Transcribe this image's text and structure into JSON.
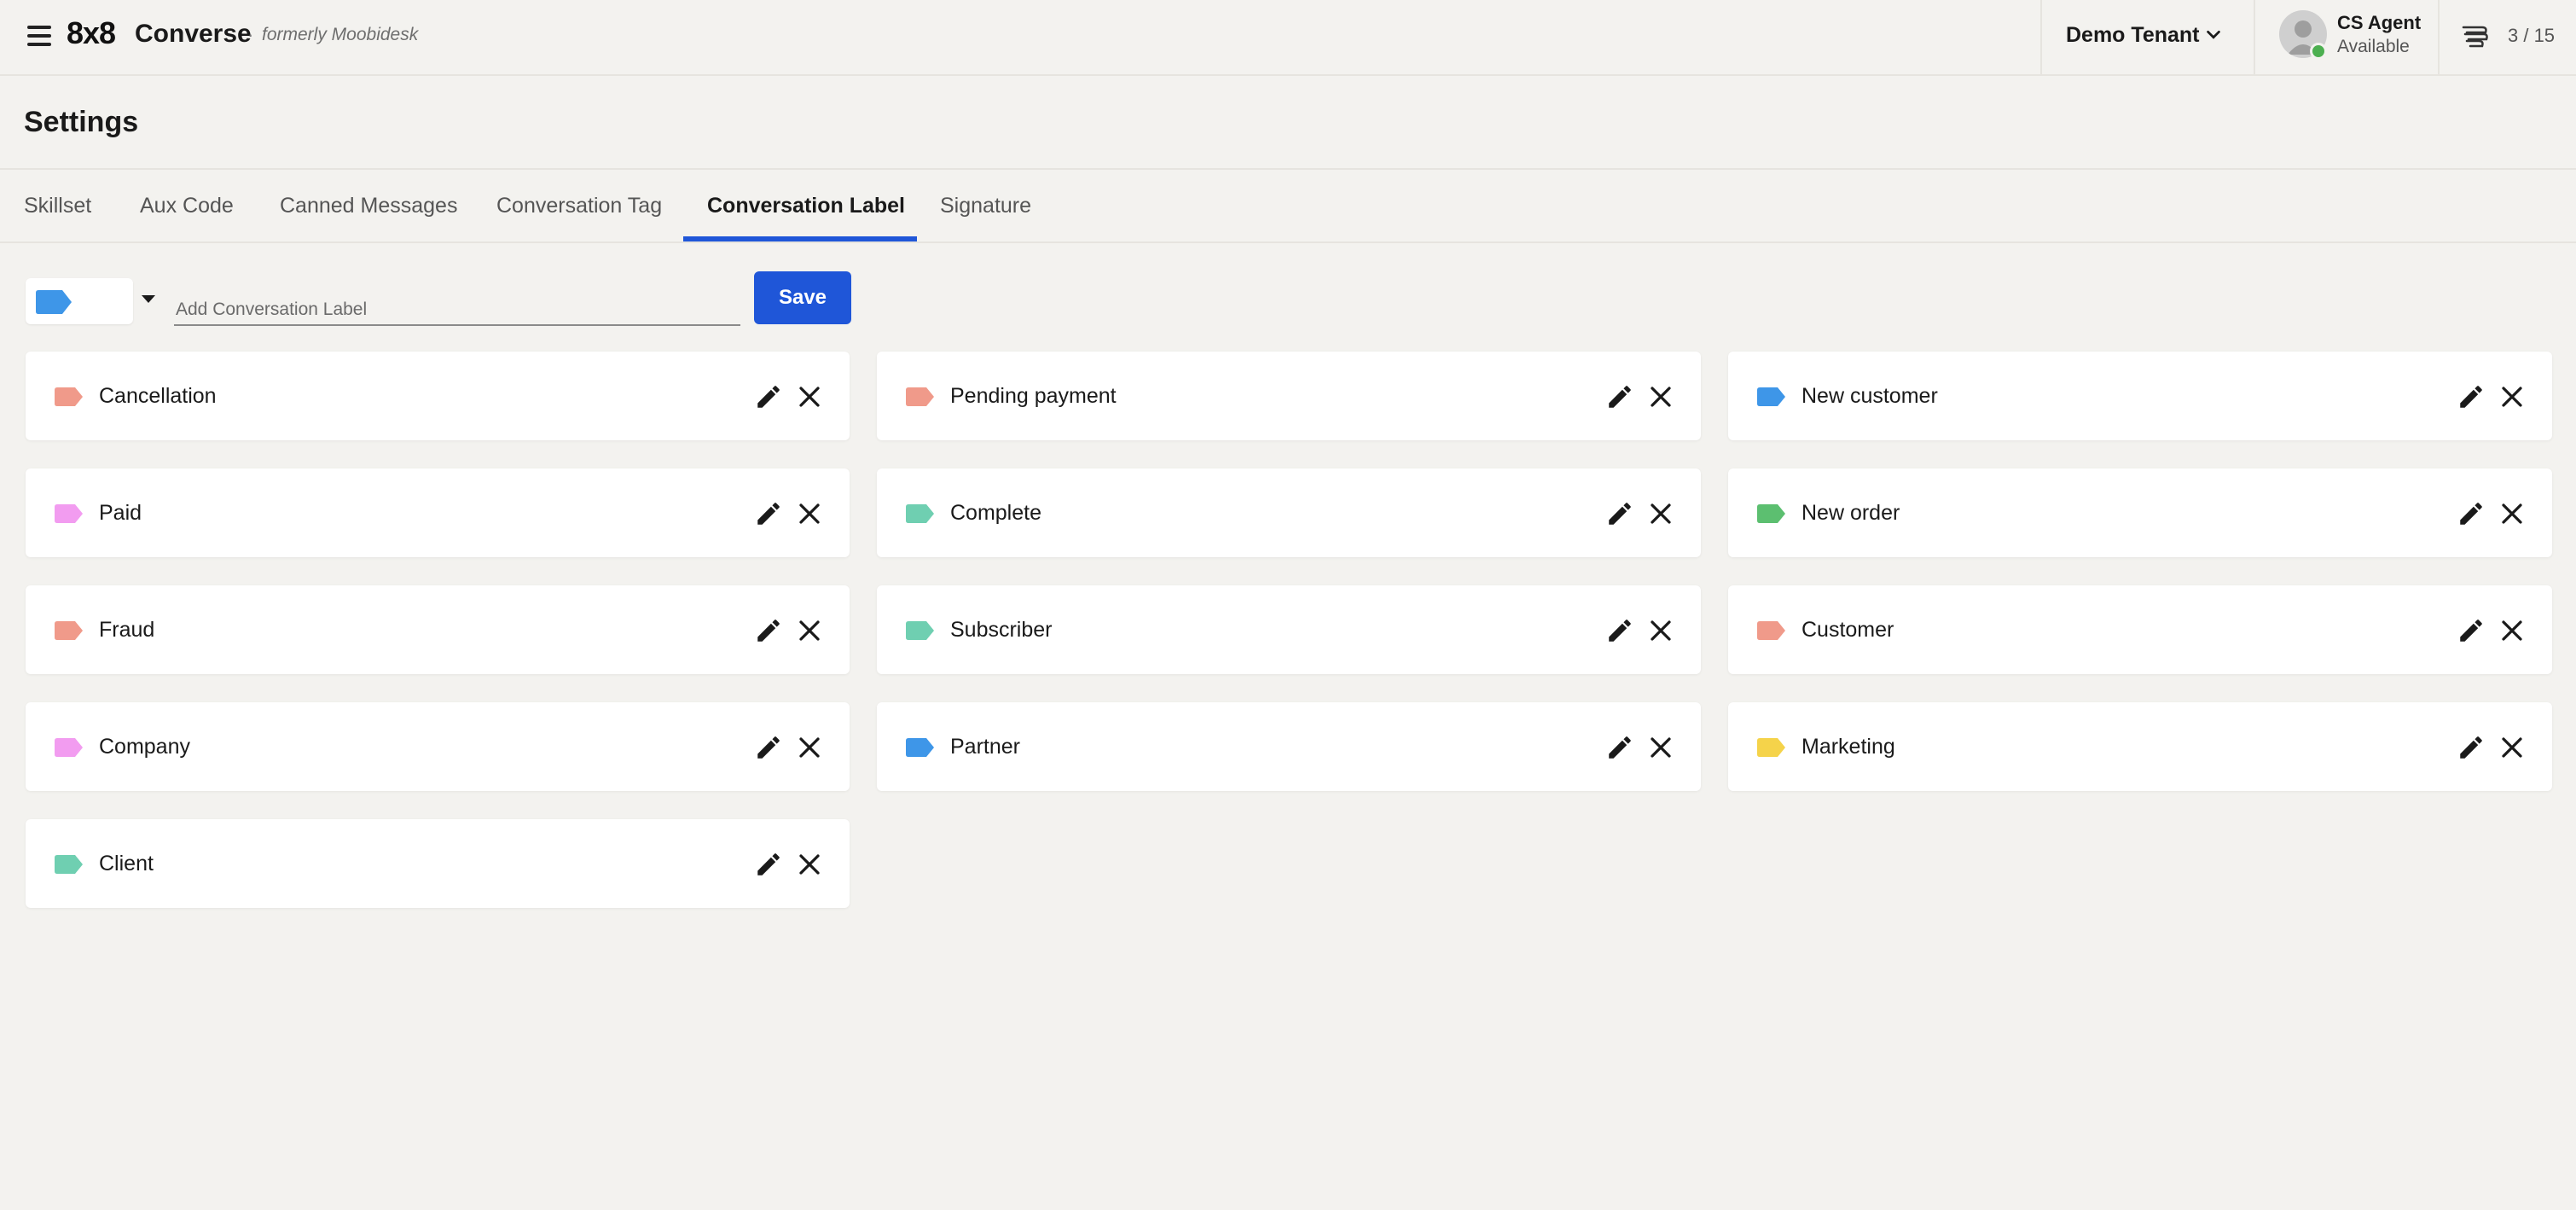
{
  "topbar": {
    "brand_logo": "8x8",
    "brand_name": "Converse",
    "brand_separator": "·",
    "brand_subtitle": "formerly Moobidesk",
    "tenant": "Demo Tenant",
    "agent_name": "CS Agent",
    "agent_status": "Available",
    "queue_count": "3 / 15",
    "status_color": "#4caf50"
  },
  "page": {
    "title": "Settings"
  },
  "tabs": [
    {
      "label": "Skillset",
      "active": false
    },
    {
      "label": "Aux Code",
      "active": false
    },
    {
      "label": "Canned Messages",
      "active": false
    },
    {
      "label": "Conversation Tag",
      "active": false
    },
    {
      "label": "Conversation Label",
      "active": true
    },
    {
      "label": "Signature",
      "active": false
    }
  ],
  "form": {
    "selected_color": "#3e96e8",
    "input_placeholder": "Add Conversation Label",
    "input_value": "",
    "save_label": "Save"
  },
  "labels": [
    {
      "name": "Cancellation",
      "color": "#f09a8a"
    },
    {
      "name": "Pending payment",
      "color": "#f09a8a"
    },
    {
      "name": "New customer",
      "color": "#3e96e8"
    },
    {
      "name": "Paid",
      "color": "#f29cf0"
    },
    {
      "name": "Complete",
      "color": "#6fcfb1"
    },
    {
      "name": "New order",
      "color": "#5cbf70"
    },
    {
      "name": "Fraud",
      "color": "#f09a8a"
    },
    {
      "name": "Subscriber",
      "color": "#6fcfb1"
    },
    {
      "name": "Customer",
      "color": "#f09a8a"
    },
    {
      "name": "Company",
      "color": "#f29cf0"
    },
    {
      "name": "Partner",
      "color": "#3e96e8"
    },
    {
      "name": "Marketing",
      "color": "#f5d34a"
    },
    {
      "name": "Client",
      "color": "#6fcfb1"
    }
  ],
  "colors": {
    "accent": "#1f56d8",
    "background": "#f3f2ef"
  }
}
